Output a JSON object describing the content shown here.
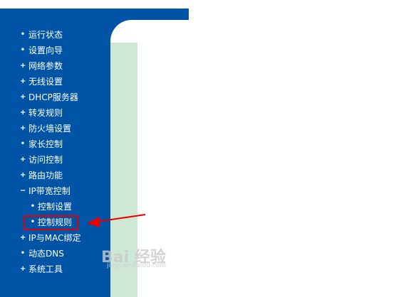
{
  "menu": [
    {
      "icon": "bullet",
      "label": "运行状态"
    },
    {
      "icon": "bullet",
      "label": "设置向导"
    },
    {
      "icon": "plus",
      "label": "网络参数"
    },
    {
      "icon": "plus",
      "label": "无线设置"
    },
    {
      "icon": "plus",
      "label": "DHCP服务器"
    },
    {
      "icon": "plus",
      "label": "转发规则"
    },
    {
      "icon": "plus",
      "label": "防火墙设置"
    },
    {
      "icon": "bullet",
      "label": "家长控制"
    },
    {
      "icon": "plus",
      "label": "访问控制"
    },
    {
      "icon": "plus",
      "label": "路由功能"
    },
    {
      "icon": "minus",
      "label": "IP带宽控制"
    },
    {
      "icon": "bullet",
      "label": "控制设置",
      "sub": true
    },
    {
      "icon": "bullet",
      "label": "控制规则",
      "sub": true,
      "highlighted": true
    },
    {
      "icon": "plus",
      "label": "IP与MAC绑定"
    },
    {
      "icon": "bullet",
      "label": "动态DNS"
    },
    {
      "icon": "plus",
      "label": "系统工具"
    }
  ],
  "watermark": {
    "text": "Bai 经验",
    "sub": "jingyan.baidu.com"
  },
  "colors": {
    "sidebar": "#0054a6",
    "highlight": "#e60000",
    "panel": "#cfe8d6"
  }
}
